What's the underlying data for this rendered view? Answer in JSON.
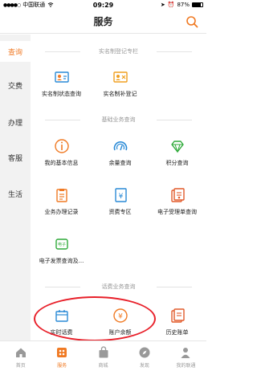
{
  "status_bar": {
    "carrier": "中国联通",
    "time": "09:29",
    "battery": "87%"
  },
  "header": {
    "title": "服务"
  },
  "sidebar": {
    "items": [
      "查询",
      "交费",
      "办理",
      "客服",
      "生活"
    ]
  },
  "sections": {
    "realname": {
      "title": "实名制登记专栏",
      "items": [
        {
          "label": "实名制状态查询",
          "icon": "id-card-icon"
        },
        {
          "label": "实名制补登记",
          "icon": "id-card-add-icon"
        }
      ]
    },
    "basic": {
      "title": "基础业务查询",
      "items": [
        {
          "label": "我的基本信息",
          "icon": "info-icon"
        },
        {
          "label": "余量查询",
          "icon": "gauge-icon"
        },
        {
          "label": "积分查询",
          "icon": "diamond-icon"
        },
        {
          "label": "业务办理记录",
          "icon": "clipboard-icon"
        },
        {
          "label": "资费专区",
          "icon": "yen-doc-icon"
        },
        {
          "label": "电子受理单查询",
          "icon": "receipt-icon"
        },
        {
          "label": "电子发票查询及...",
          "icon": "invoice-icon"
        }
      ]
    },
    "billing": {
      "title": "话费业务查询",
      "items": [
        {
          "label": "实时话费",
          "icon": "calendar-icon"
        },
        {
          "label": "账户余额",
          "icon": "yen-coin-icon"
        },
        {
          "label": "历史账单",
          "icon": "bill-icon"
        }
      ]
    }
  },
  "tabbar": {
    "items": [
      "首页",
      "服务",
      "商城",
      "发现",
      "我的联通"
    ],
    "active": "服务"
  },
  "colors": {
    "accent": "#f07a24",
    "green": "#2faa3a",
    "blue": "#2a8ad6",
    "annotation": "#e8202a"
  }
}
